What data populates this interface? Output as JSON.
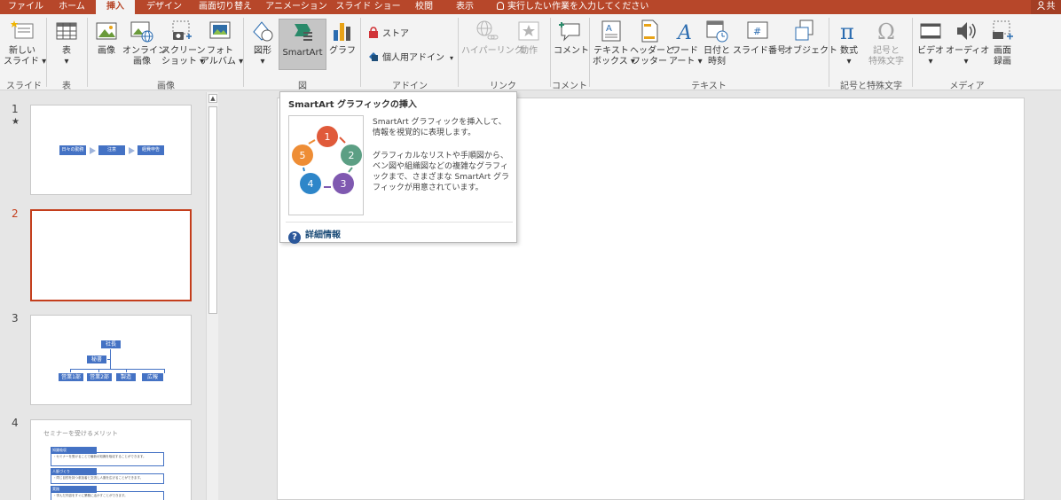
{
  "ribbon_tabs": [
    {
      "label": "ファイル"
    },
    {
      "label": "ホーム"
    },
    {
      "label": "挿入"
    },
    {
      "label": "デザイン"
    },
    {
      "label": "画面切り替え"
    },
    {
      "label": "アニメーション"
    },
    {
      "label": "スライド ショー"
    },
    {
      "label": "校閲"
    },
    {
      "label": "表示"
    }
  ],
  "tell_me": "実行したい作業を入力してください",
  "user_label": "共",
  "groups": {
    "slides": "スライド",
    "tables": "表",
    "images": "画像",
    "illustrations": "図",
    "addins": "アドイン",
    "links": "リンク",
    "comments": "コメント",
    "text": "テキスト",
    "symbols": "記号と特殊文字",
    "media": "メディア"
  },
  "buttons": {
    "new_slide": [
      "新しい",
      "スライド ▾"
    ],
    "table": [
      "表",
      "▾"
    ],
    "pictures": [
      "画像",
      ""
    ],
    "online_pictures": [
      "オンライン",
      "画像"
    ],
    "screenshot": [
      "スクリーン",
      "ショット ▾"
    ],
    "photo_album": [
      "フォト",
      "アルバム ▾"
    ],
    "shapes": [
      "図形",
      "▾"
    ],
    "smartart": "SmartArt",
    "chart": "グラフ",
    "store": "ストア",
    "my_addins": "個人用アドイン",
    "hyperlink": "ハイパーリンク",
    "action": "動作",
    "comment": "コメント",
    "textbox": [
      "テキスト",
      "ボックス ▾"
    ],
    "header_footer": [
      "ヘッダーと",
      "フッター"
    ],
    "wordart": [
      "ワード",
      "アート ▾"
    ],
    "datetime": [
      "日付と",
      "時刻"
    ],
    "slide_number": "スライド番号",
    "object": "オブジェクト",
    "equation": [
      "数式",
      "▾"
    ],
    "symbol": [
      "記号と",
      "特殊文字"
    ],
    "video": [
      "ビデオ",
      "▾"
    ],
    "audio": [
      "オーディオ",
      "▾"
    ],
    "screen_recording": [
      "画面",
      "録画"
    ]
  },
  "thumbnails": {
    "numbers": [
      "1",
      "2",
      "3",
      "4"
    ],
    "star": "★",
    "slide1_steps": [
      "日々の勤務",
      "注意",
      "経費申告"
    ],
    "slide3_org": {
      "top": "社長",
      "mid": "秘書",
      "bottom": [
        "営業1部",
        "営業2部",
        "製造",
        "広報"
      ]
    },
    "slide4": {
      "title": "セミナーを受けるメリット",
      "items": [
        {
          "head": "知識吸収",
          "body": "・セミナーを受けることで最新の知識を吸収することができます。"
        },
        {
          "head": "人脈づくり",
          "body": "・同じ目的を持つ参加者と交流し人脈を広げることができます。"
        },
        {
          "head": "実践",
          "body": "・学んだ内容をすぐに業務に活かすことができます。"
        }
      ]
    }
  },
  "tooltip": {
    "title": "SmartArt グラフィックの挿入",
    "desc1": "SmartArt グラフィックを挿入して、情報を視覚的に表現します。",
    "desc2": "グラフィカルなリストや手順図から、ベン図や組織図などの複雑なグラフィックまで、さまざまな SmartArt グラフィックが用意されています。",
    "more": "詳細情報",
    "help_glyph": "?",
    "cycle_numbers": [
      "1",
      "2",
      "3",
      "4",
      "5"
    ]
  },
  "colors": {
    "accent": "#b7472a",
    "selection": "#c43e1c",
    "smartart_blue": "#4472c4"
  }
}
